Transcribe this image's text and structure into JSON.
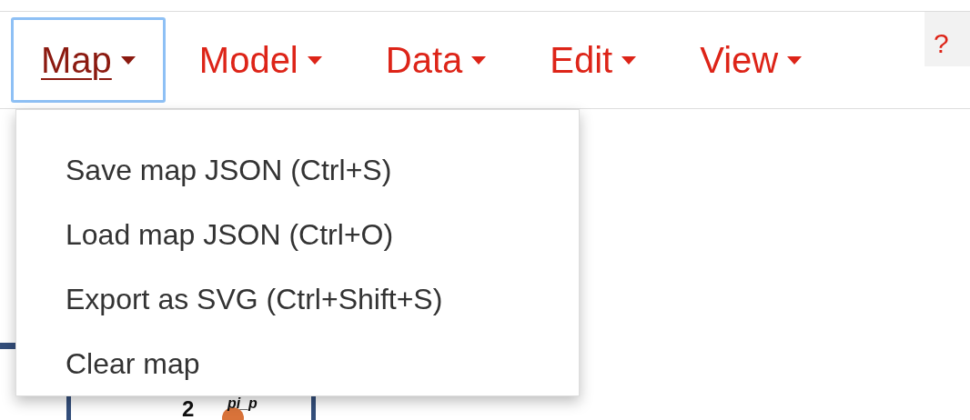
{
  "menubar": {
    "menus": [
      {
        "label": "Map",
        "selected": true
      },
      {
        "label": "Model",
        "selected": false
      },
      {
        "label": "Data",
        "selected": false
      },
      {
        "label": "Edit",
        "selected": false
      },
      {
        "label": "View",
        "selected": false
      }
    ],
    "help": "?"
  },
  "dropdown": {
    "items": [
      {
        "label": "Save map JSON (Ctrl+S)"
      },
      {
        "label": "Load map JSON (Ctrl+O)"
      },
      {
        "label": "Export as SVG (Ctrl+Shift+S)"
      },
      {
        "label": "Clear map"
      }
    ]
  },
  "map": {
    "labels": [
      {
        "kind": "coefficient",
        "text": "2"
      },
      {
        "kind": "metabolite",
        "text": "pi_p"
      }
    ]
  }
}
